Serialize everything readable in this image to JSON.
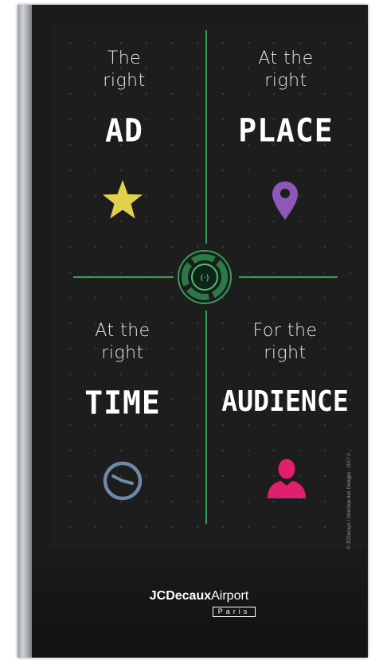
{
  "quadrants": [
    {
      "lead_line1": "The",
      "lead_line2": "right",
      "keyword": "AD",
      "icon": "star-icon",
      "icon_color": "#e1cf4e"
    },
    {
      "lead_line1": "At the",
      "lead_line2": "right",
      "keyword": "PLACE",
      "icon": "map-pin-icon",
      "icon_color": "#8e57b9"
    },
    {
      "lead_line1": "At the",
      "lead_line2": "right",
      "keyword": "TIME",
      "icon": "clock-icon",
      "icon_color": "#6f87a8"
    },
    {
      "lead_line1": "For the",
      "lead_line2": "right",
      "keyword": "AUDIENCE",
      "icon": "person-icon",
      "icon_color": "#e0206e"
    }
  ],
  "center_emblem": {
    "symbol": "(·)",
    "accent": "#2fa05a"
  },
  "credit": "© JCDecaux / Direction des Designs - 2017 //",
  "brand": {
    "name": "JCDecaux",
    "suffix": "Airport",
    "city": "Paris"
  },
  "colors": {
    "background": "#1d1d1d",
    "accent": "#2fa05a"
  }
}
